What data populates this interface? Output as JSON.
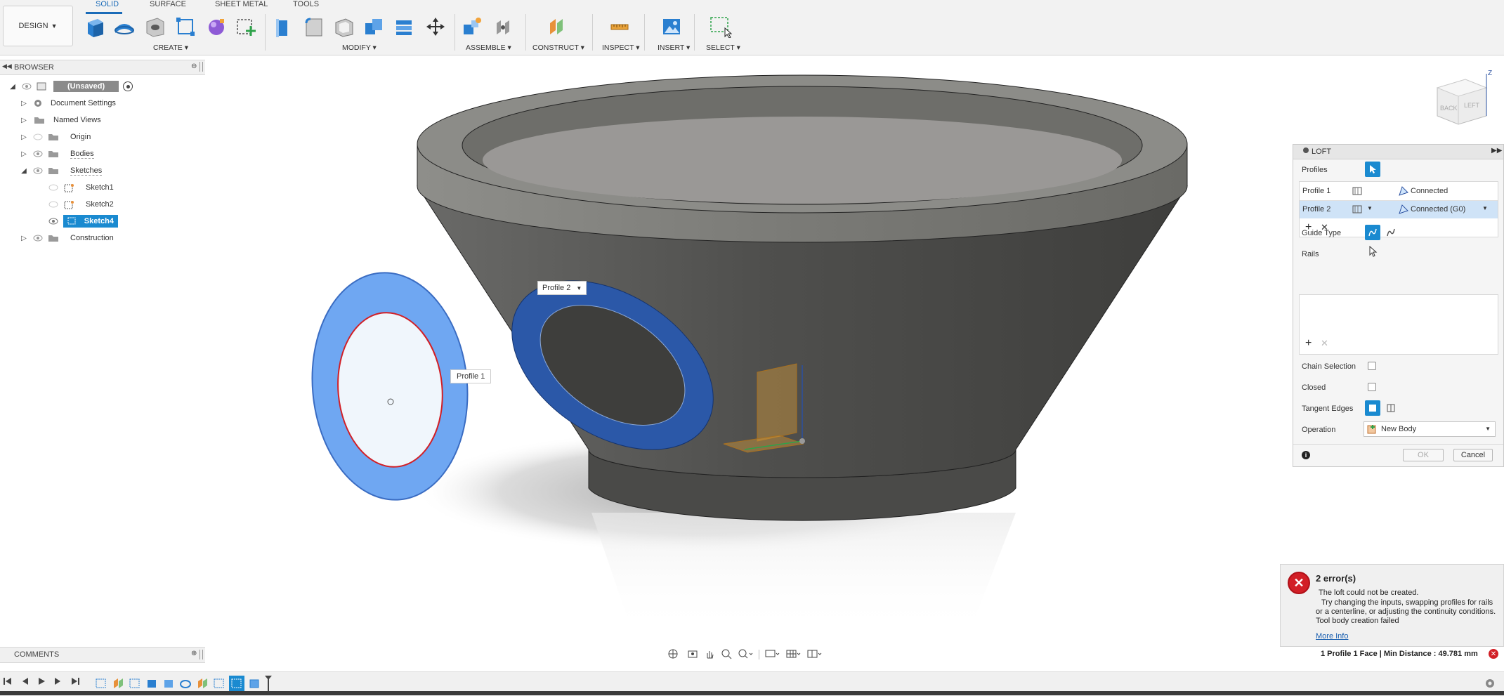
{
  "design_menu": {
    "label": "DESIGN"
  },
  "tabs": [
    {
      "label": "SOLID"
    },
    {
      "label": "SURFACE"
    },
    {
      "label": "SHEET METAL"
    },
    {
      "label": "TOOLS"
    }
  ],
  "groups": [
    {
      "label": "CREATE ▾"
    },
    {
      "label": "MODIFY ▾"
    },
    {
      "label": "ASSEMBLE ▾"
    },
    {
      "label": "CONSTRUCT ▾"
    },
    {
      "label": "INSPECT ▾"
    },
    {
      "label": "INSERT ▾"
    },
    {
      "label": "SELECT ▾"
    }
  ],
  "browser": {
    "title": "BROWSER",
    "items": [
      {
        "label": "(Unsaved)"
      },
      {
        "label": "Document Settings"
      },
      {
        "label": "Named Views"
      },
      {
        "label": "Origin"
      },
      {
        "label": "Bodies"
      },
      {
        "label": "Sketches"
      },
      {
        "label": "Sketch1"
      },
      {
        "label": "Sketch2"
      },
      {
        "label": "Sketch4"
      },
      {
        "label": "Construction"
      }
    ]
  },
  "viewport": {
    "profile1_label": "Profile 1",
    "profile2_label": "Profile 2"
  },
  "viewcube": {
    "back": "BACK",
    "left": "LEFT",
    "axis_z": "Z"
  },
  "loft": {
    "title": "LOFT",
    "profiles_label": "Profiles",
    "profile_rows": [
      {
        "name": "Profile 1",
        "condition": "Connected"
      },
      {
        "name": "Profile 2",
        "condition": "Connected (G0)"
      }
    ],
    "guide_type_label": "Guide Type",
    "rails_label": "Rails",
    "chain_selection_label": "Chain Selection",
    "closed_label": "Closed",
    "tangent_edges_label": "Tangent Edges",
    "operation_label": "Operation",
    "operation_value": "New Body",
    "ok_label": "OK",
    "cancel_label": "Cancel"
  },
  "error": {
    "title": "2 error(s)",
    "line1": "The loft could not be created.",
    "line2": "Try changing the inputs, swapping profiles for rails",
    "line3": "or a centerline, or adjusting the continuity conditions.",
    "line4": "Tool body creation failed",
    "more_info": "More Info"
  },
  "status": {
    "text": "1 Profile 1 Face | Min Distance : 49.781 mm"
  },
  "comments": {
    "label": "COMMENTS"
  },
  "colors": {
    "accent": "#1a8ad0",
    "body": "#5a5a58",
    "profile_fill": "#6fa7f2",
    "error_red": "#d21f26"
  }
}
